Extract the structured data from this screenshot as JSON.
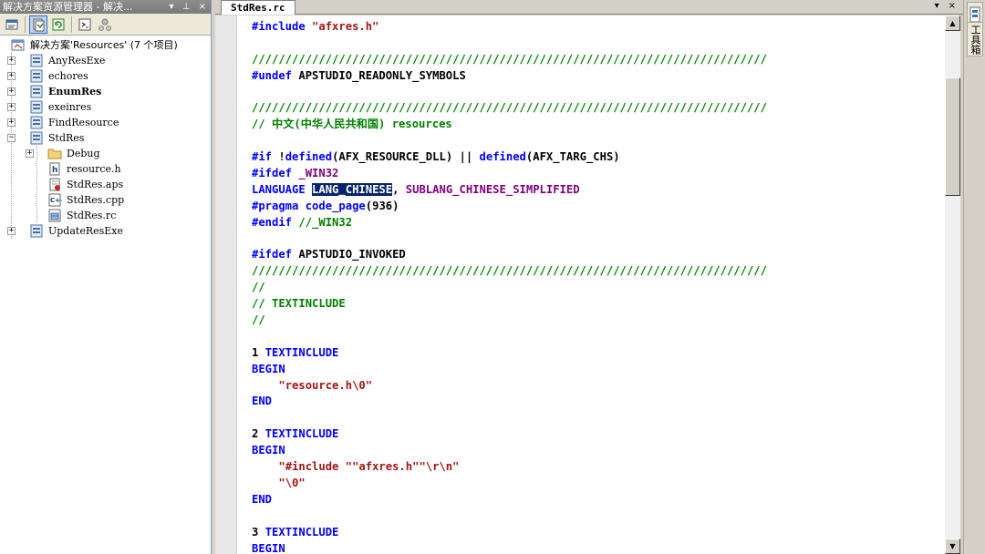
{
  "solution_explorer": {
    "title": "解决方案资源管理器 - 解决...",
    "title_controls": "▾ ⊥ ×",
    "root_label": "解决方案'Resources' (7 个项目)",
    "items": [
      {
        "label": "AnyResExe",
        "bold": false
      },
      {
        "label": "echores",
        "bold": false
      },
      {
        "label": "EnumRes",
        "bold": true
      },
      {
        "label": "exeinres",
        "bold": false
      },
      {
        "label": "FindResource",
        "bold": false
      },
      {
        "label": "StdRes",
        "bold": false
      },
      {
        "label": "Debug",
        "bold": false
      },
      {
        "label": "resource.h",
        "bold": false
      },
      {
        "label": "StdRes.aps",
        "bold": false
      },
      {
        "label": "StdRes.cpp",
        "bold": false
      },
      {
        "label": "StdRes.rc",
        "bold": false
      },
      {
        "label": "UpdateResExe",
        "bold": false
      }
    ]
  },
  "editor": {
    "tab_label": "StdRes.rc",
    "tab_controls": [
      "▾",
      "×"
    ],
    "lines": [
      [
        [
          "kw",
          "#include"
        ],
        [
          "tx",
          " "
        ],
        [
          "st",
          "\"afxres.h\""
        ]
      ],
      [],
      [
        [
          "cm",
          "/////////////////////////////////////////////////////////////////////////////"
        ]
      ],
      [
        [
          "kw",
          "#undef"
        ],
        [
          "tx",
          " APSTUDIO_READONLY_SYMBOLS"
        ]
      ],
      [],
      [
        [
          "cm",
          "/////////////////////////////////////////////////////////////////////////////"
        ]
      ],
      [
        [
          "cm",
          "// 中文(中华人民共和国) resources"
        ]
      ],
      [],
      [
        [
          "kw",
          "#if"
        ],
        [
          "tx",
          " !"
        ],
        [
          "kw",
          "defined"
        ],
        [
          "tx",
          "(AFX_RESOURCE_DLL) || "
        ],
        [
          "kw",
          "defined"
        ],
        [
          "tx",
          "(AFX_TARG_CHS)"
        ]
      ],
      [
        [
          "kw",
          "#ifdef"
        ],
        [
          "tx",
          " "
        ],
        [
          "mc",
          "_WIN32"
        ]
      ],
      [
        [
          "kw",
          "LANGUAGE"
        ],
        [
          "tx",
          " "
        ],
        [
          "sel",
          "LANG_CHINESE"
        ],
        [
          "tx",
          ", "
        ],
        [
          "mc",
          "SUBLANG_CHINESE_SIMPLIFIED"
        ]
      ],
      [
        [
          "kw",
          "#pragma"
        ],
        [
          "tx",
          " "
        ],
        [
          "kw",
          "code_page"
        ],
        [
          "tx",
          "(936)"
        ]
      ],
      [
        [
          "kw",
          "#endif"
        ],
        [
          "tx",
          " "
        ],
        [
          "cm",
          "//_WIN32"
        ]
      ],
      [],
      [
        [
          "kw",
          "#ifdef"
        ],
        [
          "tx",
          " APSTUDIO_INVOKED"
        ]
      ],
      [
        [
          "cm",
          "/////////////////////////////////////////////////////////////////////////////"
        ]
      ],
      [
        [
          "cm",
          "//"
        ]
      ],
      [
        [
          "cm",
          "// TEXTINCLUDE"
        ]
      ],
      [
        [
          "cm",
          "//"
        ]
      ],
      [],
      [
        [
          "tx",
          "1 "
        ],
        [
          "kw",
          "TEXTINCLUDE"
        ]
      ],
      [
        [
          "kw",
          "BEGIN"
        ]
      ],
      [
        [
          "tx",
          "    "
        ],
        [
          "st",
          "\"resource.h\\0\""
        ]
      ],
      [
        [
          "kw",
          "END"
        ]
      ],
      [],
      [
        [
          "tx",
          "2 "
        ],
        [
          "kw",
          "TEXTINCLUDE"
        ]
      ],
      [
        [
          "kw",
          "BEGIN"
        ]
      ],
      [
        [
          "tx",
          "    "
        ],
        [
          "st",
          "\"#include \"\"afxres.h\"\"\\r\\n\""
        ]
      ],
      [
        [
          "tx",
          "    "
        ],
        [
          "st",
          "\"\\0\""
        ]
      ],
      [
        [
          "kw",
          "END"
        ]
      ],
      [],
      [
        [
          "tx",
          "3 "
        ],
        [
          "kw",
          "TEXTINCLUDE"
        ]
      ],
      [
        [
          "kw",
          "BEGIN"
        ]
      ]
    ]
  },
  "right_strip": {
    "tabs": [
      "",
      "工具箱"
    ]
  },
  "colors": {
    "keyword": "#0000ff",
    "comment": "#008000",
    "string": "#a31515",
    "macro": "#800080",
    "selection_bg": "#0a246a"
  }
}
